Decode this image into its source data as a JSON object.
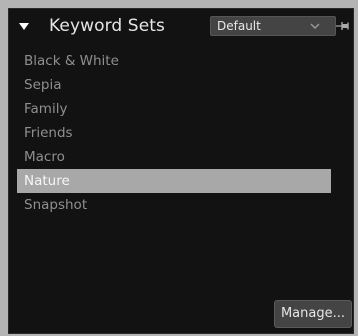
{
  "panel": {
    "title": "Keyword Sets",
    "collapse_icon": "triangle-down-icon",
    "preset_select": {
      "selected": "Default",
      "icon": "chevron-down-icon"
    },
    "pin_icon": "pin-icon"
  },
  "keyword_sets": [
    {
      "label": "Black & White",
      "selected": false
    },
    {
      "label": "Sepia",
      "selected": false
    },
    {
      "label": "Family",
      "selected": false
    },
    {
      "label": "Friends",
      "selected": false
    },
    {
      "label": "Macro",
      "selected": false
    },
    {
      "label": "Nature",
      "selected": true
    },
    {
      "label": "Snapshot",
      "selected": false
    }
  ],
  "footer": {
    "manage_label": "Manage..."
  },
  "colors": {
    "panel_background": "#121212",
    "selected_row": "#a8a8a8",
    "item_text": "#8f8f8f",
    "outer_background": "#b4b4b4"
  }
}
